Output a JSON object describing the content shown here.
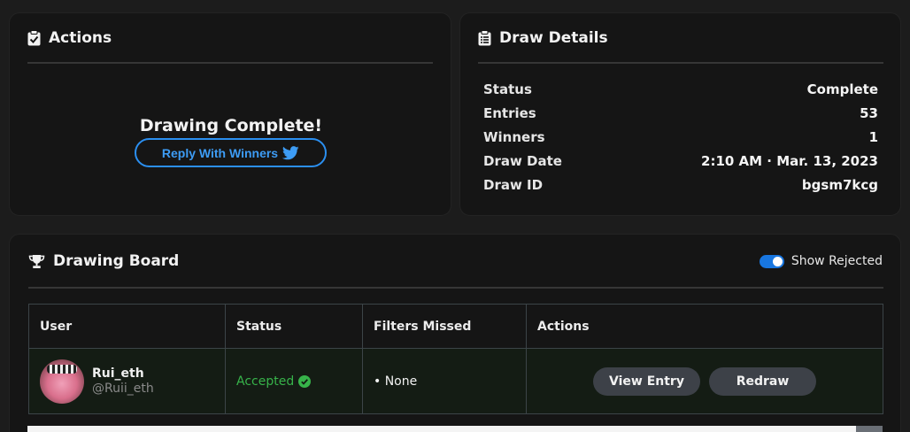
{
  "actions": {
    "title": "Actions",
    "status_heading": "Drawing Complete!",
    "reply_button": "Reply With Winners"
  },
  "details": {
    "title": "Draw Details",
    "rows": [
      {
        "key": "Status",
        "value": "Complete"
      },
      {
        "key": "Entries",
        "value": "53"
      },
      {
        "key": "Winners",
        "value": "1"
      },
      {
        "key": "Draw Date",
        "value": "2:10 AM · Mar. 13, 2023"
      },
      {
        "key": "Draw ID",
        "value": "bgsm7kcg"
      }
    ]
  },
  "board": {
    "title": "Drawing Board",
    "toggle_label": "Show Rejected",
    "toggle_on": true,
    "columns": [
      "User",
      "Status",
      "Filters Missed",
      "Actions"
    ],
    "rows": [
      {
        "name": "Rui_eth",
        "handle": "@Ruii_eth",
        "status": "Accepted",
        "filters": "• None",
        "view_button": "View Entry",
        "redraw_button": "Redraw"
      }
    ]
  },
  "colors": {
    "accent_blue": "#2b8ff0",
    "accepted_green": "#37b34a",
    "card_bg": "#151515",
    "page_bg": "#1c1c1c"
  }
}
